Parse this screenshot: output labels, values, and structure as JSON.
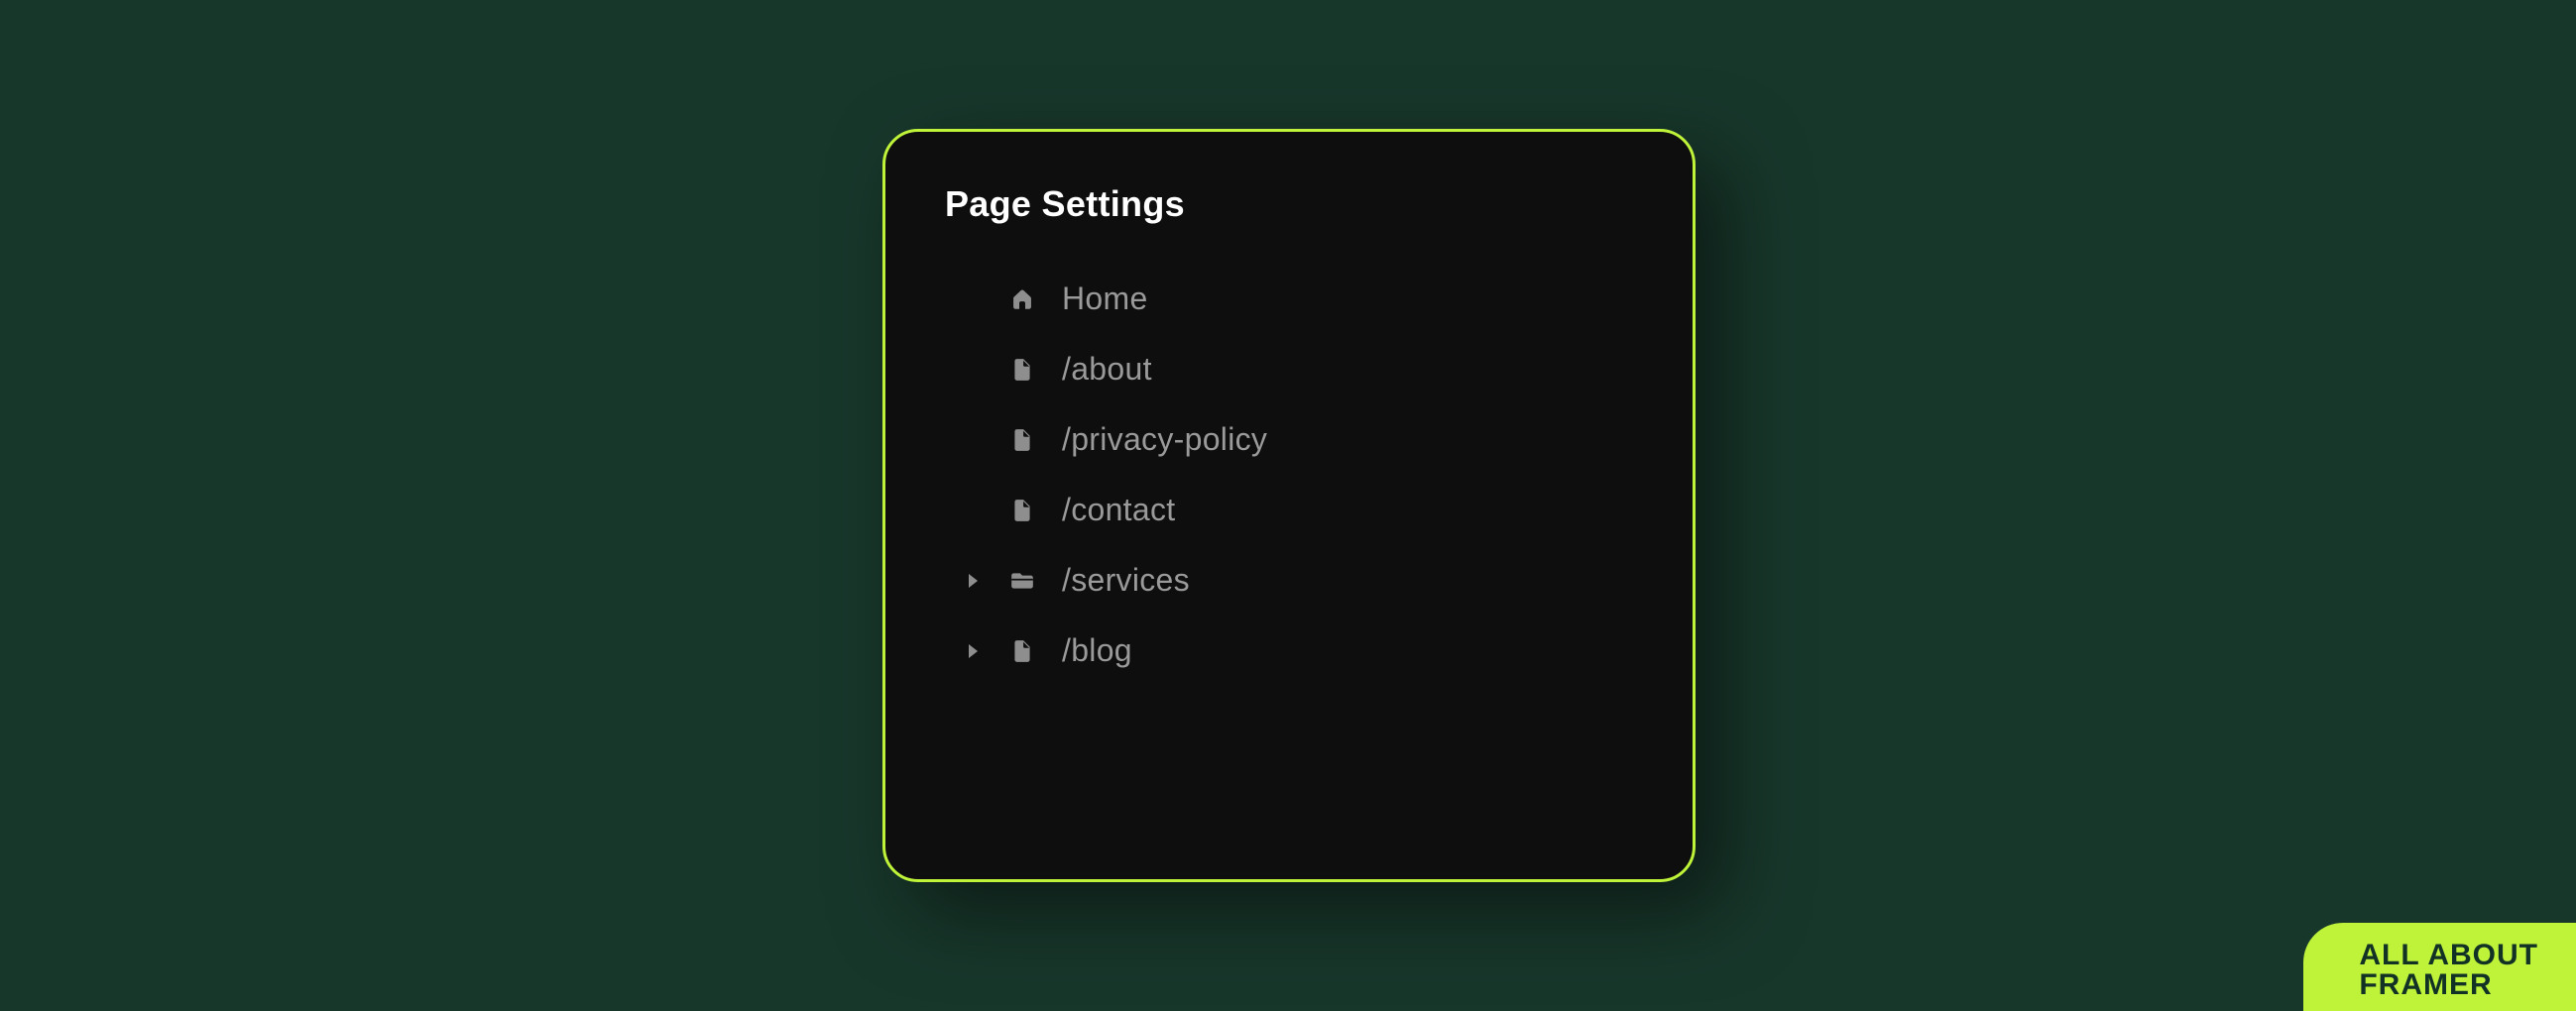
{
  "panel": {
    "title": "Page Settings",
    "items": [
      {
        "label": "Home",
        "icon": "home",
        "expandable": false
      },
      {
        "label": "/about",
        "icon": "file",
        "expandable": false
      },
      {
        "label": "/privacy-policy",
        "icon": "file",
        "expandable": false
      },
      {
        "label": "/contact",
        "icon": "file",
        "expandable": false
      },
      {
        "label": "/services",
        "icon": "folder",
        "expandable": true
      },
      {
        "label": "/blog",
        "icon": "file",
        "expandable": true
      }
    ]
  },
  "brand": {
    "line1": "ALL ABOUT",
    "line2": "FRAMER"
  },
  "colors": {
    "background": "#18372b",
    "panel_bg": "#0e0e0e",
    "accent": "#bff33a",
    "text_muted": "#9a9a9a"
  }
}
